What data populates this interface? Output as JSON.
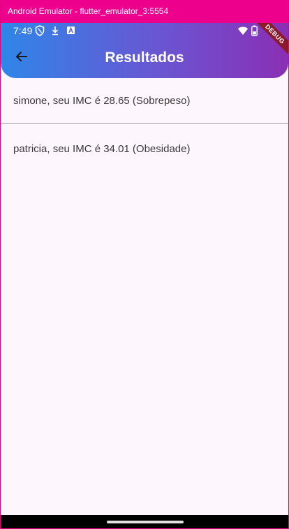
{
  "window": {
    "title": "Android Emulator - flutter_emulator_3:5554"
  },
  "status_bar": {
    "time": "7:49",
    "debug_banner": "DEBUG"
  },
  "app_bar": {
    "title": "Resultados"
  },
  "results": [
    {
      "text": "simone, seu IMC é 28.65 (Sobrepeso)"
    },
    {
      "text": "patricia, seu IMC é 34.01 (Obesidade)"
    }
  ],
  "icons": {
    "back": "arrow-back-icon",
    "status": [
      "shield-icon",
      "download-icon",
      "a-icon",
      "wifi-icon",
      "battery-icon"
    ]
  },
  "colors": {
    "title_bar": "#ec008c",
    "gradient_start": "#2f86e8",
    "gradient_end": "#8a2fb4",
    "background": "#fdf6fd",
    "debug_ribbon": "#8b1a2b"
  }
}
